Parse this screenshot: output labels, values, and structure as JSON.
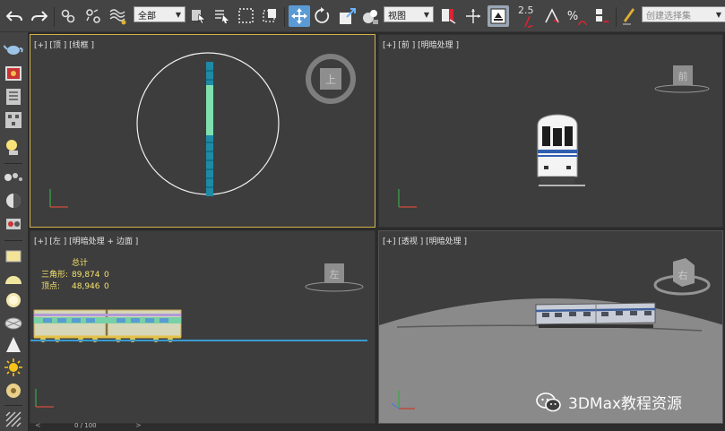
{
  "toolbar": {
    "selection_filter": "全部",
    "ref_coord": "视图",
    "angle_snap_label": "2.5",
    "named_selection_placeholder": "创建选择集",
    "icons": [
      "undo-icon",
      "redo-icon",
      "link-icon",
      "unlink-icon",
      "bind-spacewarp-icon",
      "select-object-icon",
      "select-by-name-icon",
      "rect-region-icon",
      "window-crossing-icon",
      "move-icon",
      "rotate-icon",
      "scale-icon",
      "use-pivot-icon",
      "select-manipulate-icon",
      "mirror-icon",
      "align-icon",
      "layer-icon",
      "snap-toggle-icon",
      "angle-snap-icon",
      "percent-snap-icon",
      "spinner-snap-icon",
      "edit-named-sel-icon"
    ]
  },
  "viewports": {
    "top": {
      "label": "[+] [顶 ] [线框 ]",
      "cube_face": "上"
    },
    "front": {
      "label": "[+] [前 ] [明暗处理 ]",
      "cube_face": "前"
    },
    "left": {
      "label": "[+] [左 ] [明暗处理 + 边面 ]",
      "cube_face": "左",
      "stats": {
        "title": "总计",
        "tri_label": "三角形:",
        "tri_value": "89,874",
        "tri_sel": "0",
        "vert_label": "顶点:",
        "vert_value": "48,946",
        "vert_sel": "0"
      }
    },
    "persp": {
      "label": "[+] [透视 ] [明暗处理 ]",
      "cube_face": "右"
    }
  },
  "timeline": {
    "frame": "0 / 100"
  },
  "watermark": {
    "text": "3DMax教程资源"
  },
  "colors": {
    "active_border": "#d4b24a",
    "accent": "#5b9bd5",
    "viewport_bg": "#3d3d3d"
  }
}
